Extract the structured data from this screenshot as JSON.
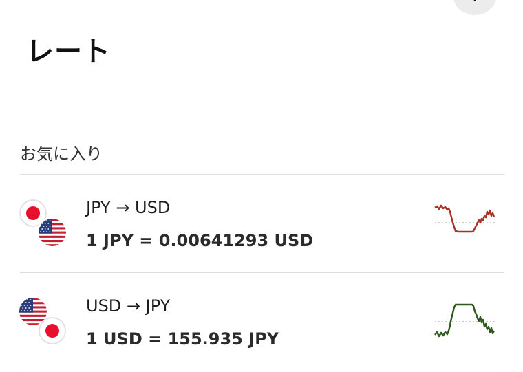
{
  "header": {
    "title": "レート",
    "add_glyph": "+"
  },
  "favorites": {
    "label": "お気に入り",
    "rates": [
      {
        "pair": "JPY → USD",
        "value": "1 JPY = 0.00641293 USD",
        "base_flag": "japan-flag-icon",
        "quote_flag": "us-flag-icon",
        "trend_color": "#a83224"
      },
      {
        "pair": "USD → JPY",
        "value": "1 USD = 155.935 JPY",
        "base_flag": "us-flag-icon",
        "quote_flag": "japan-flag-icon",
        "trend_color": "#2f5a1d"
      }
    ]
  }
}
